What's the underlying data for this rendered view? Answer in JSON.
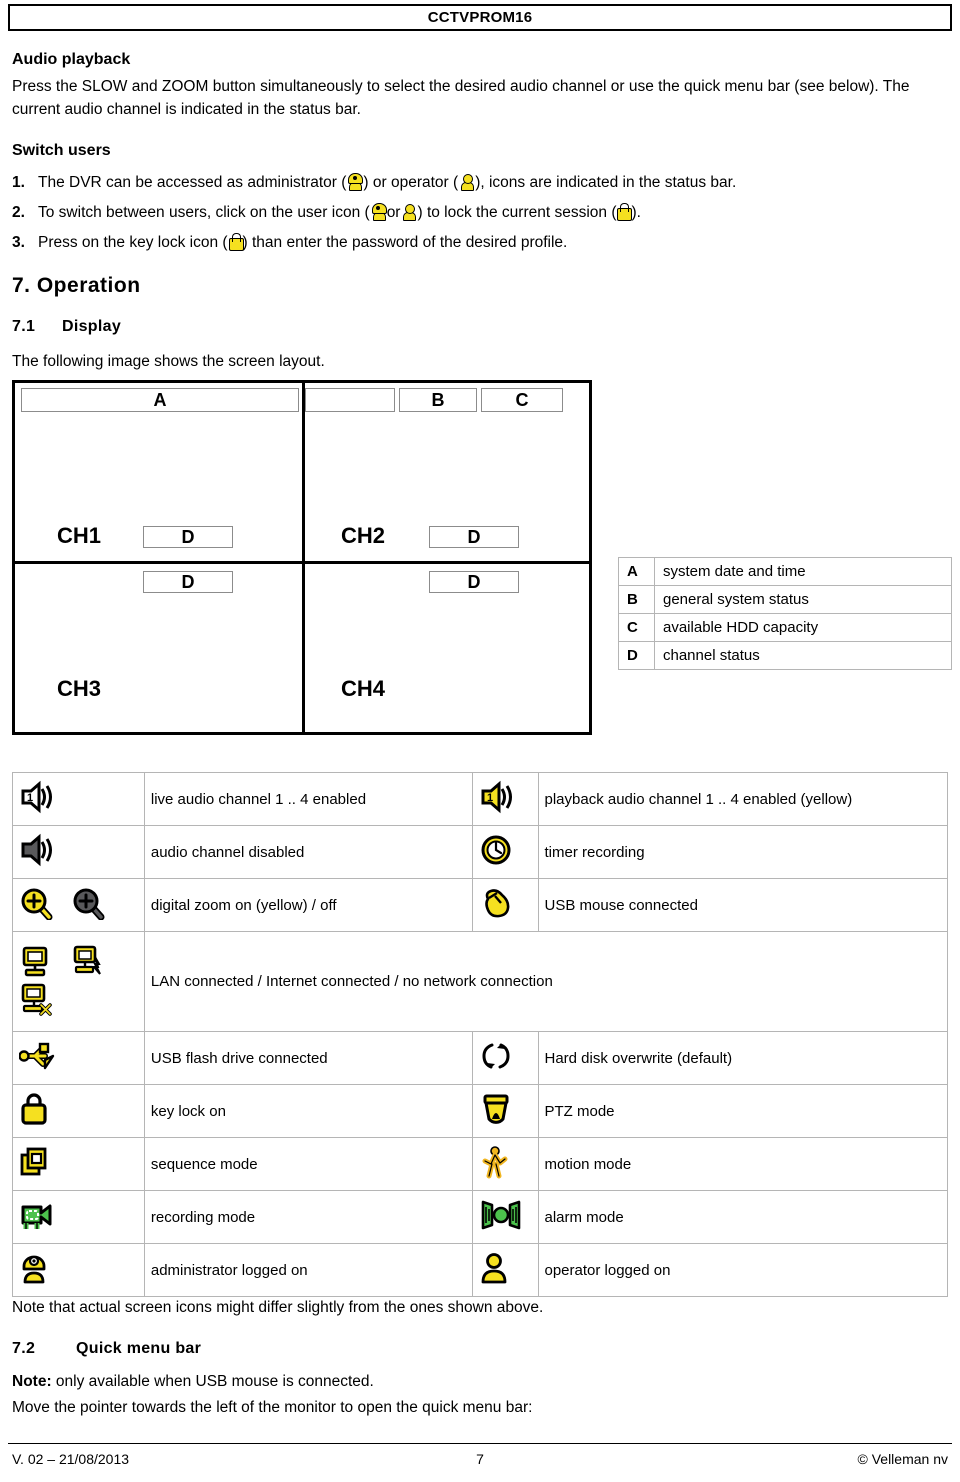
{
  "header": {
    "title": "CCTVPROM16"
  },
  "sections": {
    "audio_playback": {
      "heading": "Audio playback",
      "para": "Press the SLOW and ZOOM button simultaneously to select the desired audio channel or use the quick menu bar (see below). The current audio channel is indicated in the status bar."
    },
    "switch_users": {
      "heading": "Switch users",
      "items": [
        {
          "index": "1.",
          "part1": "The DVR can be accessed as administrator (",
          "icon1": "administrator-icon",
          "part2": ") or operator (",
          "icon2": "operator-icon",
          "part3": "), icons are indicated in the status bar."
        },
        {
          "index": "2.",
          "part1": "To switch between users, click on the user icon (",
          "icon1": "administrator-icon",
          "part2": "or",
          "icon2": "operator-icon",
          "part3": ") to lock the current session (",
          "icon3": "key-lock-icon",
          "part4": ")."
        },
        {
          "index": "3.",
          "part1": "Press on the key lock icon (",
          "icon1": "key-lock-icon",
          "part2": ") than enter the password of the desired profile."
        }
      ]
    },
    "operation": {
      "heading": "7. Operation",
      "display": {
        "number": "7.1",
        "title": "Display",
        "intro": "The following image shows the screen layout."
      },
      "quick_menu": {
        "number": "7.2",
        "title": "Quick menu bar",
        "note_label": "Note:",
        "note_text": " only available when USB mouse is connected.",
        "line": "Move the pointer towards the left of the monitor to open the quick menu bar:"
      }
    }
  },
  "screen_layout": {
    "labels": {
      "A": "A",
      "B": "B",
      "C": "C",
      "D": "D"
    },
    "channels": [
      "CH1",
      "CH2",
      "CH3",
      "CH4"
    ]
  },
  "legend": {
    "rows": [
      {
        "key": "A",
        "desc": "system date and time"
      },
      {
        "key": "B",
        "desc": "general system status"
      },
      {
        "key": "C",
        "desc": "available HDD capacity"
      },
      {
        "key": "D",
        "desc": "channel status"
      }
    ]
  },
  "icon_legend": {
    "rows": [
      {
        "left_icons": [
          "speaker-on-1-icon"
        ],
        "left_text": "live audio channel 1 .. 4 enabled",
        "right_icons": [
          "speaker-on-yellow-1-icon"
        ],
        "right_text": "playback audio channel 1 .. 4 enabled (yellow)"
      },
      {
        "left_icons": [
          "speaker-muted-icon"
        ],
        "left_text": "audio channel disabled",
        "right_icons": [
          "clock-timer-icon"
        ],
        "right_text": "timer recording"
      },
      {
        "left_icons": [
          "zoom-in-yellow-icon",
          "zoom-in-grey-icon"
        ],
        "left_text": "digital zoom on (yellow) / off",
        "right_icons": [
          "usb-mouse-icon"
        ],
        "right_text": "USB mouse connected"
      },
      {
        "left_icons": [
          "lan-connected-icon",
          "internet-connected-icon",
          "no-network-icon"
        ],
        "left_text": "LAN connected / Internet connected / no network connection",
        "span": true
      },
      {
        "left_icons": [
          "usb-flash-drive-icon"
        ],
        "left_text": "USB flash drive connected",
        "right_icons": [
          "hdd-overwrite-icon"
        ],
        "right_text": "Hard disk overwrite (default)"
      },
      {
        "left_icons": [
          "key-lock-icon"
        ],
        "left_text": "key lock on",
        "right_icons": [
          "ptz-dome-icon"
        ],
        "right_text": "PTZ mode"
      },
      {
        "left_icons": [
          "sequence-mode-icon"
        ],
        "left_text": "sequence mode",
        "right_icons": [
          "motion-person-icon"
        ],
        "right_text": "motion mode"
      },
      {
        "left_icons": [
          "recording-camera-icon"
        ],
        "left_text": "recording mode",
        "right_icons": [
          "alarm-bell-icon"
        ],
        "right_text": "alarm mode"
      },
      {
        "left_icons": [
          "administrator-icon"
        ],
        "left_text": "administrator logged on",
        "right_icons": [
          "operator-icon"
        ],
        "right_text": "operator logged on"
      }
    ],
    "note": "Note that actual screen icons might differ slightly from the ones shown above."
  },
  "footer": {
    "version": "V. 02 – 21/08/2013",
    "page": "7",
    "copyright": "© Velleman nv"
  },
  "colors": {
    "accent_yellow": "#f5e020",
    "grey_icon": "#59595b",
    "green": "#4cc24c",
    "border_grey": "#b5b5b5",
    "black": "#000000"
  }
}
